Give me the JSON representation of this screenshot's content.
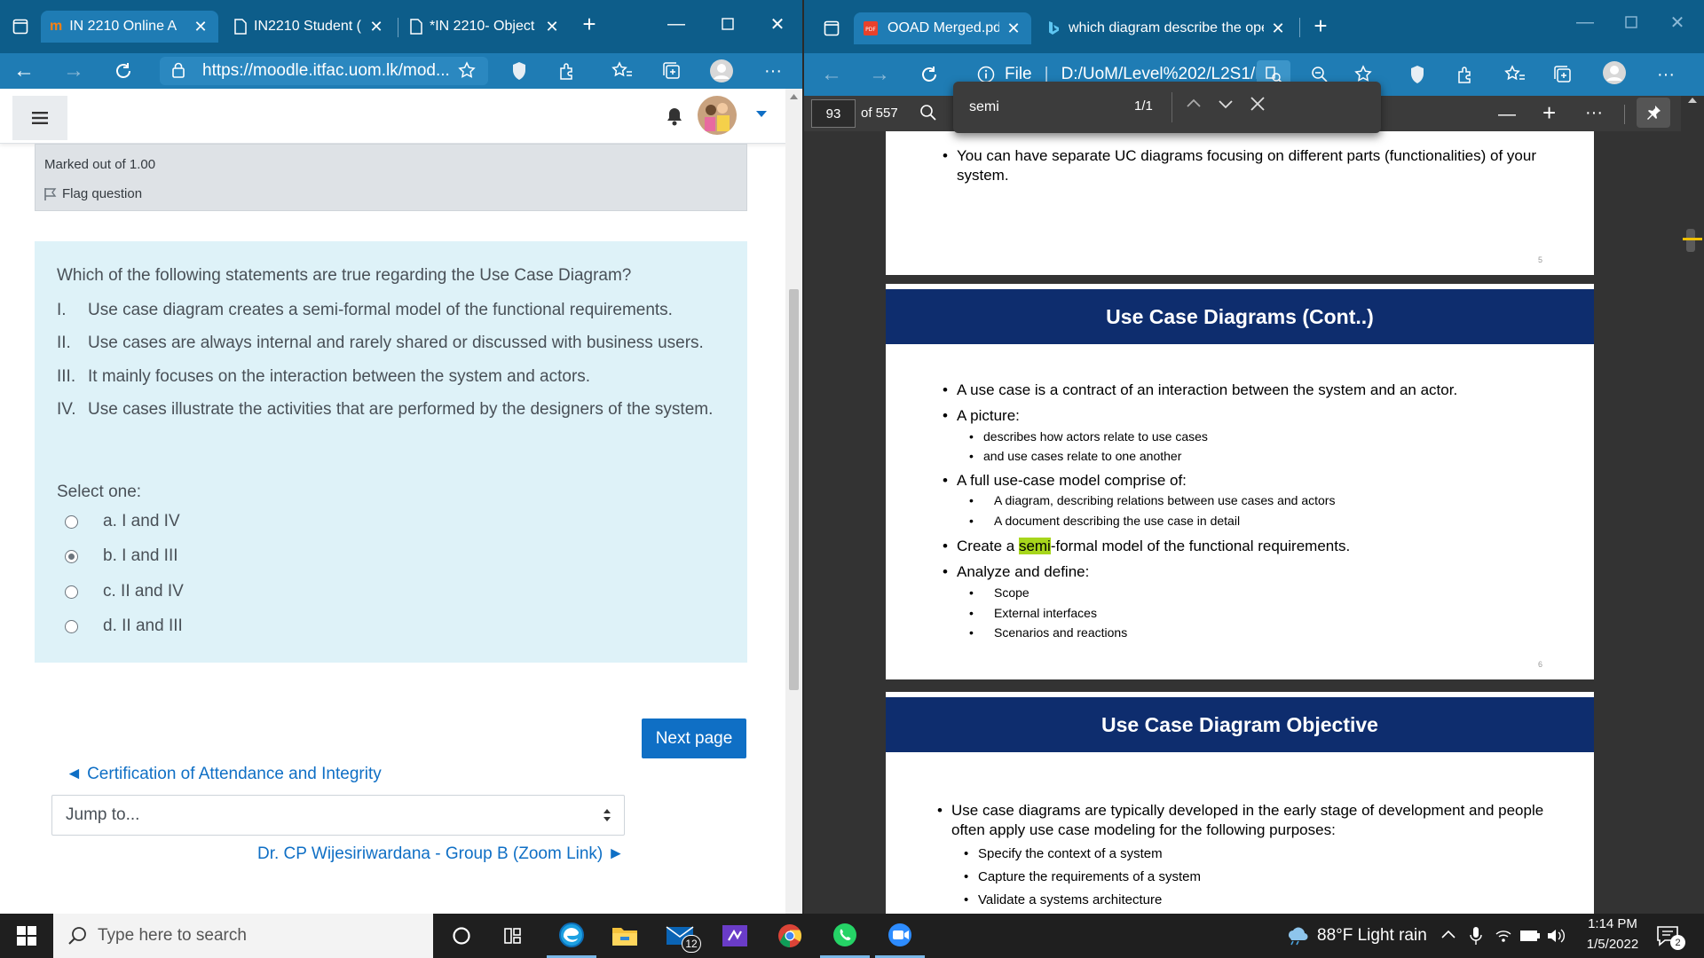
{
  "left_browser": {
    "tabs": [
      {
        "title": "IN 2210 Online A",
        "icon": "moodle-icon"
      },
      {
        "title": "IN2210 Student (",
        "icon": "page-icon"
      },
      {
        "title": "*IN 2210- Object",
        "icon": "page-icon"
      }
    ],
    "address": "https://moodle.itfac.uom.lk/mod..."
  },
  "question": {
    "marked": "Marked out of 1.00",
    "flag": "Flag question",
    "text": "Which of the following statements are true regarding the Use Case Diagram?",
    "statements": [
      {
        "num": "I.",
        "text": "Use case diagram creates a semi-formal model of the functional requirements."
      },
      {
        "num": "II.",
        "text": "Use cases are always internal and rarely shared or discussed with business users."
      },
      {
        "num": "III.",
        "text": "It mainly focuses on the interaction between the system and actors."
      },
      {
        "num": "IV.",
        "text": "Use cases illustrate the activities that are performed by the designers of the system."
      }
    ],
    "select_label": "Select one:",
    "options": [
      {
        "label": "a. I and IV",
        "checked": false
      },
      {
        "label": "b. I and III",
        "checked": true
      },
      {
        "label": "c. II and IV",
        "checked": false
      },
      {
        "label": "d. II and III",
        "checked": false
      }
    ]
  },
  "navigation": {
    "next_page": "Next page",
    "prev_link": "◄ Certification of Attendance and Integrity",
    "jump_placeholder": "Jump to...",
    "next_link": "Dr. CP Wijesiriwardana - Group B (Zoom Link) ►"
  },
  "right_browser": {
    "tabs": [
      {
        "title": "OOAD Merged.pdf",
        "icon": "pdf-icon"
      },
      {
        "title": "which diagram describe the oper",
        "icon": "bing-icon"
      }
    ],
    "address_prefix": "File",
    "address": "D:/UoM/Level%202/L2S1/I..."
  },
  "pdf": {
    "page_current": "93",
    "page_total": "of 557",
    "find_query": "semi",
    "find_count": "1/1",
    "page_a": {
      "bullet": "You can have separate UC diagrams focusing on different parts (functionalities) of your",
      "bullet_cont": "system.",
      "page_num": "5"
    },
    "page_b": {
      "title": "Use Case Diagrams (Cont..)",
      "b1": "A use case is a contract of an interaction between the system and an actor.",
      "b2": "A picture:",
      "b2a": "describes how actors relate to use cases",
      "b2b": "and use cases relate to one another",
      "b3": "A full use-case model comprise of:",
      "b3a": "A diagram, describing relations between use cases and actors",
      "b3b": "A document describing the use case in detail",
      "b4_pre": "Create a ",
      "b4_hl": "semi",
      "b4_post": "-formal model of the functional requirements.",
      "b5": "Analyze and define:",
      "b5a": "Scope",
      "b5b": "External interfaces",
      "b5c": "Scenarios and reactions",
      "page_num": "6"
    },
    "page_c": {
      "title": "Use Case Diagram Objective",
      "b1": "Use case diagrams are typically developed in the early stage of development and people",
      "b1_cont": "often apply use case modeling for the following purposes:",
      "b1a": "Specify the context of a system",
      "b1b": "Capture the requirements of a system",
      "b1c": "Validate a systems architecture"
    }
  },
  "taskbar": {
    "search_placeholder": "Type here to search",
    "mail_badge": "12",
    "weather": "88°F  Light rain",
    "time": "1:14 PM",
    "date": "1/5/2022",
    "notification_count": "2"
  },
  "colors": {
    "browser_dark": "#0d5d8a",
    "browser_light": "#1f7cb4",
    "moodle_blue": "#0f6fc5",
    "question_bg": "#def2f8",
    "slide_title_bg": "#0e2d6e",
    "highlight": "#a7d61c"
  }
}
